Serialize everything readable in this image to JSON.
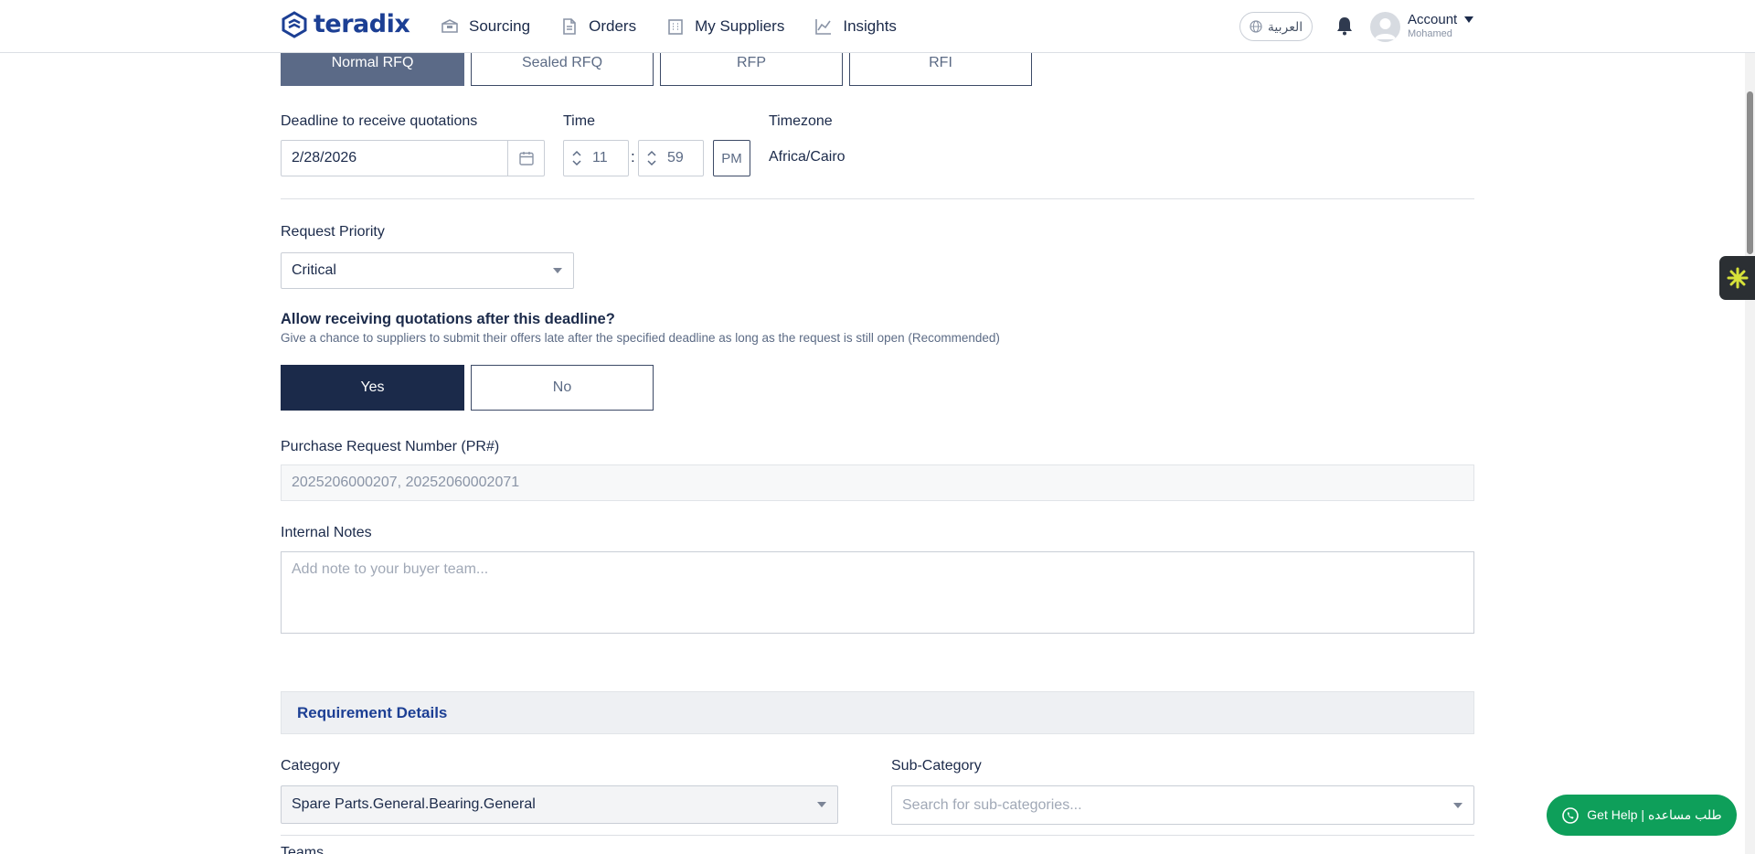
{
  "header": {
    "brand": "teradix",
    "nav": [
      {
        "label": "Sourcing",
        "icon": "box-icon"
      },
      {
        "label": "Orders",
        "icon": "document-icon"
      },
      {
        "label": "My Suppliers",
        "icon": "building-icon"
      },
      {
        "label": "Insights",
        "icon": "chart-icon"
      }
    ],
    "language": "العربية",
    "account_label": "Account",
    "account_user": "Mohamed"
  },
  "request_types": [
    "Normal RFQ",
    "Sealed RFQ",
    "RFP",
    "RFI"
  ],
  "active_request_type": "Normal RFQ",
  "deadline": {
    "label": "Deadline to receive quotations",
    "date": "2/28/2026",
    "time_label": "Time",
    "hour": "11",
    "minute": "59",
    "separator": ":",
    "ampm": "PM",
    "timezone_label": "Timezone",
    "timezone": "Africa/Cairo"
  },
  "priority": {
    "label": "Request Priority",
    "value": "Critical"
  },
  "late_quotes": {
    "question": "Allow receiving quotations after this deadline?",
    "help": "Give a chance to suppliers to submit their offers late after the specified deadline as long as the request is still open (Recommended)",
    "yes": "Yes",
    "no": "No",
    "selected": "Yes"
  },
  "pr": {
    "label": "Purchase Request Number (PR#)",
    "value": "2025206000207, 20252060002071"
  },
  "notes": {
    "label": "Internal Notes",
    "placeholder": "Add note to your buyer team..."
  },
  "requirements": {
    "title": "Requirement Details",
    "category_label": "Category",
    "category_value": "Spare Parts.General.Bearing.General",
    "subcategory_label": "Sub-Category",
    "subcategory_placeholder": "Search for sub-categories...",
    "teams_label": "Teams"
  },
  "help_button": "Get Help | طلب مساعده",
  "colors": {
    "brand": "#1c3f94",
    "navy": "#1b2a4a",
    "active_segment": "#5b6a87",
    "whatsapp": "#0e9f5a"
  }
}
